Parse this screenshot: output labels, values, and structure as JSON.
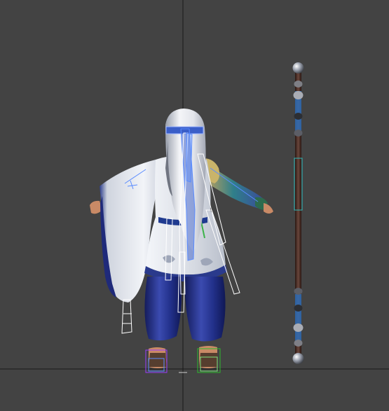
{
  "viewport": {
    "background": "#434343",
    "grid_axis_color": "#1a1a1a",
    "bone_color": "#5a8cff",
    "selection_box_color": "#e8e8e8",
    "staff_shaft_color": "#4a2d25",
    "staff_accent_color": "#2f6fb8",
    "robe_color": "#dfe3ea",
    "trousers_color": "#1f2a7a"
  },
  "scene": {
    "objects": [
      {
        "name": "character-model",
        "type": "mesh"
      },
      {
        "name": "staff-weapon",
        "type": "mesh"
      },
      {
        "name": "biped-rig",
        "type": "bones"
      }
    ]
  }
}
